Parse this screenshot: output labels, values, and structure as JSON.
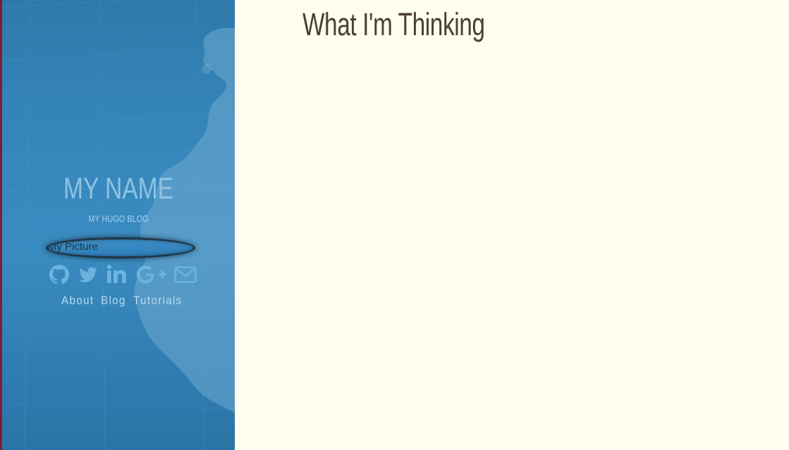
{
  "sidebar": {
    "title": "MY NAME",
    "subtitle": "MY HUGO BLOG",
    "avatar_alt": "My Picture",
    "social": [
      {
        "icon": "github-icon"
      },
      {
        "icon": "twitter-icon"
      },
      {
        "icon": "linkedin-icon"
      },
      {
        "icon": "google-plus-icon"
      },
      {
        "icon": "envelope-icon"
      }
    ],
    "nav": [
      {
        "label": "About"
      },
      {
        "label": "Blog"
      },
      {
        "label": "Tutorials"
      }
    ]
  },
  "main": {
    "title": "What I'm Thinking"
  },
  "colors": {
    "sidebar_bg": "#3686bb",
    "page_bg": "#fffdee",
    "title_text": "#4a3f31",
    "sidebar_text": "#8ec3e3",
    "left_edge": "#7a1f3a"
  }
}
